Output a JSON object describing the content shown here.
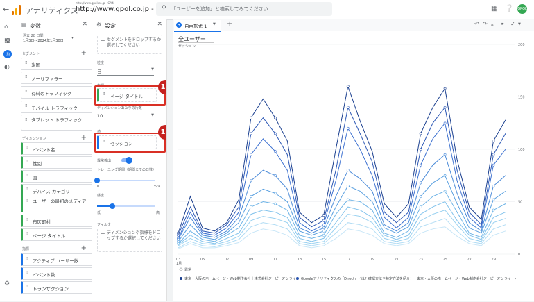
{
  "topbar": {
    "back_icon": "arrow-left-icon",
    "brand": "アナリティクス",
    "property_small": "http://www.gpol.co.jp - GA4",
    "property": "http://www.gpol.co.jp - GA4",
    "search_placeholder": "「ユーザーを追加」と検索してみてください",
    "avatar": "GPOL"
  },
  "leftnav": {
    "items": [
      "home-icon",
      "reports-icon",
      "explore-icon",
      "advertising-icon"
    ],
    "settings": "settings-icon"
  },
  "variables": {
    "title": "変数",
    "date_label": "過去 28 日間",
    "date_range": "1月3日～2024年1月30日",
    "segments_label": "セグメント",
    "segments": [
      "米国",
      "ノーリファラー",
      "有料のトラフィック",
      "モバイル トラフィック",
      "タブレット トラフィック"
    ],
    "dimensions_label": "ディメンション",
    "dimensions": [
      "イベント名",
      "性別",
      "国",
      "デバイス カテゴリ",
      "ユーザーの最初のメディア",
      "市区町村",
      "ページ タイトル"
    ],
    "metrics_label": "指標",
    "metrics": [
      "アクティブ ユーザー数",
      "イベント数",
      "トランザクション"
    ]
  },
  "settings": {
    "title": "設定",
    "segment_drop": "セグメントをドロップするか選択してください",
    "granularity_label": "粒度",
    "granularity_value": "日",
    "breakdown_label": "内訳",
    "breakdown_value": "ページ タイトル",
    "rows_label": "ディメンションあたりの行数",
    "rows_value": "10",
    "values_label": "値",
    "values_value": "セッション",
    "anomaly_label": "異常検出",
    "training_label": "トレーニング期間（期間までの日数）",
    "training_min": "0",
    "training_max": "399",
    "sensitivity_label": "感度",
    "sensitivity_low": "低",
    "sensitivity_high": "高",
    "filter_label": "フィルタ",
    "filter_drop": "ディメンションや指標をドロップするか選択してください",
    "badge1": "11",
    "badge2": "12"
  },
  "canvas": {
    "tab_label": "自由形式 1",
    "add_tab": "+",
    "tools": [
      "undo-icon",
      "redo-icon",
      "download-icon",
      "share-icon",
      "status-check-icon"
    ]
  },
  "chart_data": {
    "type": "line",
    "title": "全ユーザー",
    "ylabel": "セッション",
    "ylim": [
      0,
      200
    ],
    "yticks": [
      "200",
      "150",
      "100",
      "50",
      "0"
    ],
    "x_tick_labels": [
      "03\n1月",
      "05",
      "07",
      "09",
      "11",
      "13",
      "15",
      "17",
      "19",
      "21",
      "23",
      "25",
      "27",
      "29"
    ],
    "categories": [
      "03",
      "04",
      "05",
      "06",
      "07",
      "08",
      "09",
      "10",
      "11",
      "12",
      "13",
      "14",
      "15",
      "16",
      "17",
      "18",
      "19",
      "20",
      "21",
      "22",
      "23",
      "24",
      "25",
      "26",
      "27",
      "28",
      "29",
      "30"
    ],
    "legend_top": "異常",
    "legend_series": [
      "東京・大阪のホームページ・Web制作会社｜株式会社ジーピーオンライン",
      "Googleアナリティクスの「Direct」とは？確認方法や特定方法を紹介！｜東京・大阪のホームページ・Web制作会社ジーピーオンライ"
    ],
    "series": [
      {
        "color": "#1a3f8f",
        "values": [
          20,
          55,
          25,
          22,
          30,
          52,
          130,
          148,
          130,
          108,
          40,
          30,
          37,
          100,
          160,
          127,
          98,
          48,
          35,
          48,
          115,
          140,
          158,
          90,
          45,
          33,
          108,
          128
        ]
      },
      {
        "color": "#2b57b5",
        "values": [
          18,
          45,
          22,
          20,
          28,
          45,
          115,
          130,
          115,
          95,
          35,
          26,
          32,
          80,
          140,
          115,
          88,
          40,
          30,
          40,
          100,
          125,
          140,
          80,
          40,
          28,
          95,
          115
        ]
      },
      {
        "color": "#3a6fd0",
        "values": [
          15,
          40,
          20,
          18,
          25,
          40,
          95,
          110,
          98,
          80,
          30,
          22,
          28,
          70,
          120,
          100,
          75,
          35,
          25,
          35,
          85,
          110,
          125,
          70,
          35,
          25,
          85,
          100
        ]
      },
      {
        "color": "#4a8ad8",
        "values": [
          14,
          35,
          18,
          16,
          22,
          35,
          70,
          80,
          75,
          62,
          25,
          20,
          25,
          55,
          80,
          72,
          60,
          28,
          22,
          30,
          68,
          85,
          95,
          58,
          30,
          22,
          65,
          75
        ]
      },
      {
        "color": "#5aa0e0",
        "values": [
          12,
          28,
          16,
          14,
          20,
          30,
          55,
          62,
          58,
          50,
          22,
          18,
          22,
          45,
          65,
          60,
          50,
          25,
          20,
          26,
          55,
          68,
          75,
          48,
          25,
          20,
          52,
          60
        ]
      },
      {
        "color": "#6db3e6",
        "values": [
          10,
          22,
          14,
          12,
          18,
          25,
          45,
          50,
          48,
          42,
          18,
          15,
          18,
          38,
          52,
          50,
          42,
          20,
          16,
          22,
          45,
          55,
          60,
          40,
          20,
          16,
          42,
          48
        ]
      },
      {
        "color": "#83c3ec",
        "values": [
          9,
          18,
          12,
          10,
          15,
          20,
          38,
          42,
          40,
          35,
          15,
          12,
          15,
          30,
          45,
          42,
          35,
          18,
          14,
          18,
          38,
          45,
          50,
          32,
          18,
          14,
          35,
          40
        ]
      },
      {
        "color": "#9ad1f0",
        "values": [
          8,
          15,
          10,
          9,
          12,
          17,
          32,
          36,
          34,
          30,
          12,
          10,
          12,
          25,
          38,
          36,
          30,
          15,
          12,
          15,
          32,
          38,
          42,
          28,
          15,
          12,
          30,
          34
        ]
      },
      {
        "color": "#b1dcf4",
        "values": [
          6,
          12,
          8,
          7,
          10,
          14,
          26,
          30,
          28,
          24,
          10,
          8,
          10,
          20,
          30,
          28,
          24,
          12,
          10,
          12,
          26,
          30,
          34,
          22,
          12,
          10,
          24,
          28
        ]
      },
      {
        "color": "#c8e6f7",
        "values": [
          5,
          10,
          6,
          6,
          8,
          11,
          20,
          24,
          22,
          18,
          8,
          6,
          8,
          15,
          24,
          22,
          18,
          10,
          8,
          10,
          20,
          24,
          26,
          17,
          10,
          8,
          18,
          22
        ]
      }
    ]
  }
}
